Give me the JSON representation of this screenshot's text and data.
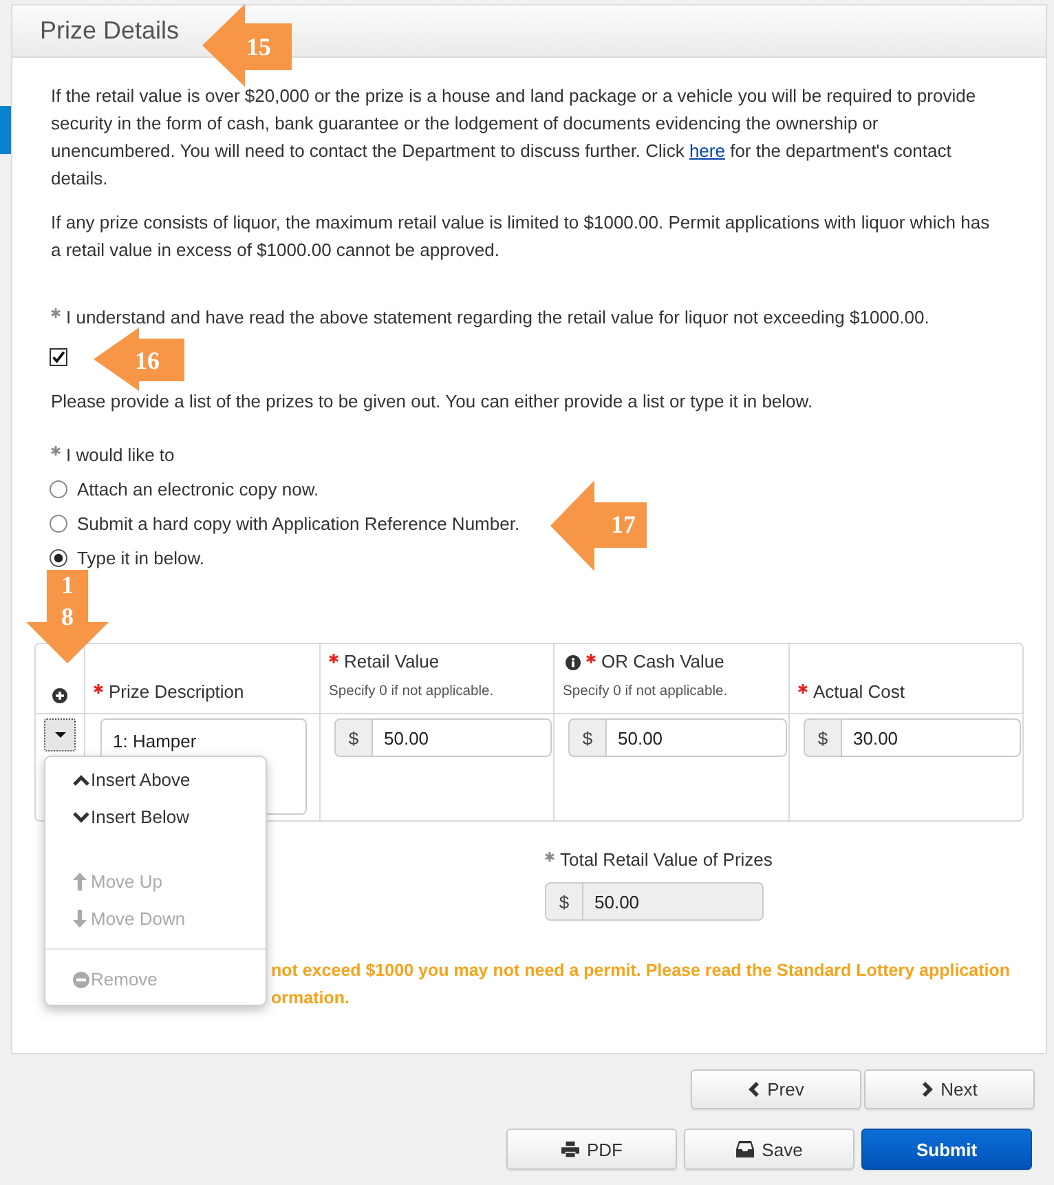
{
  "panel": {
    "title": "Prize Details",
    "callout": "15"
  },
  "intro": [
    {
      "before": "If the retail value is over $20,000 or the prize is a house and land package or a vehicle you will be required to provide security in the form of cash, bank guarantee or the lodgement of documents evidencing the ownership or unencumbered. You will need to contact the Department to discuss further. Click ",
      "link": "here",
      "after": " for the department's contact details."
    },
    {
      "before": "If any prize consists of liquor, the maximum retail value is limited to $1000.00. Permit applications with liquor which has a retail value in excess of $1000.00 cannot be approved."
    }
  ],
  "acknowledgement": {
    "label": "I understand and have read the above statement regarding the retail value for liquor not exceeding $1000.00.",
    "required": true,
    "checked": true,
    "callout": "16"
  },
  "list_prompt": "Please provide a list of the prizes to be given out. You can either provide a list or type it in below.",
  "choice": {
    "label": "I would like to",
    "required": true,
    "options": [
      {
        "label": "Attach an electronic copy now.",
        "selected": false
      },
      {
        "label": "Submit a hard copy with Application Reference Number.",
        "selected": false,
        "callout": "17"
      },
      {
        "label": "Type it in below.",
        "selected": true
      }
    ]
  },
  "prize_table": {
    "callout": "18",
    "columns": [
      {
        "label": "Prize Description",
        "required": true,
        "info": false
      },
      {
        "label": "Retail Value",
        "required": true,
        "info": false,
        "hint": "Specify 0 if not applicable."
      },
      {
        "label": "OR Cash Value",
        "required": true,
        "info": true,
        "hint": "Specify 0 if not applicable."
      },
      {
        "label": "Actual Cost",
        "required": true,
        "info": false
      }
    ],
    "rows": [
      {
        "menu_open": true,
        "cells": [
          {
            "kind": "text",
            "value": "1: Hamper"
          },
          {
            "kind": "money",
            "prefix": "$",
            "value": "50.00"
          },
          {
            "kind": "money",
            "prefix": "$",
            "value": "50.00"
          },
          {
            "kind": "money",
            "prefix": "$",
            "value": "30.00"
          }
        ]
      }
    ],
    "row_menu": {
      "groups": [
        {
          "divider": false,
          "items": [
            {
              "kind": "above",
              "label": "Insert Above",
              "disabled": false
            },
            {
              "kind": "below",
              "label": "Insert Below",
              "disabled": false
            }
          ]
        },
        {
          "divider": false,
          "items": [
            {
              "kind": "up",
              "label": "Move Up",
              "disabled": true
            },
            {
              "kind": "down",
              "label": "Move Down",
              "disabled": true
            }
          ]
        },
        {
          "divider": true,
          "items": [
            {
              "kind": "remove",
              "label": "Remove",
              "disabled": true
            }
          ]
        }
      ]
    }
  },
  "total": {
    "label": "Total Retail Value of Prizes",
    "required": true,
    "prefix": "$",
    "value": "50.00",
    "readonly": true
  },
  "warning": [
    "not exceed $1000 you may not need a permit. Please read the Standard Lottery application",
    "ormation."
  ],
  "navigation": [
    {
      "kind": "prev",
      "label": "Prev"
    },
    {
      "kind": "next",
      "label": "Next"
    }
  ],
  "actions": [
    {
      "kind": "pdf",
      "label": "PDF"
    },
    {
      "kind": "save",
      "label": "Save"
    },
    {
      "kind": "submit",
      "label": "Submit"
    }
  ]
}
